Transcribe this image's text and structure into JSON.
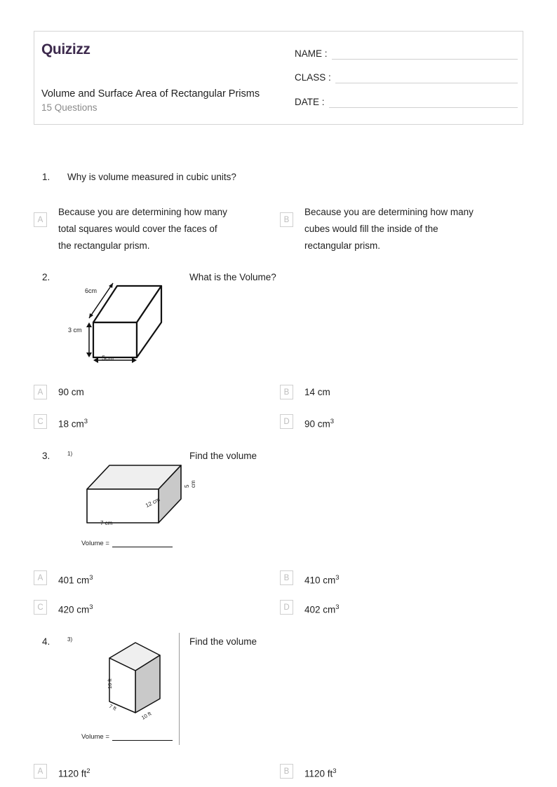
{
  "header": {
    "logo": "Quizizz",
    "title": "Volume and Surface Area of Rectangular Prisms",
    "question_count": "15 Questions",
    "fields": [
      {
        "label": "NAME :",
        "value": ""
      },
      {
        "label": "CLASS :",
        "value": ""
      },
      {
        "label": "DATE  :",
        "value": ""
      }
    ],
    "logo_color": "#3d2a4d"
  },
  "questions": [
    {
      "number": "1.",
      "prompt": "Why is volume measured in cubic units?",
      "options": [
        {
          "letter": "A",
          "line1": "Because you are determining how many",
          "line2": "total squares would cover the faces of",
          "line3": "the rectangular prism."
        },
        {
          "letter": "B",
          "line1": "Because you are determining how many",
          "line2": "cubes would fill the inside of the",
          "line3": "rectangular prism."
        }
      ]
    },
    {
      "number": "2.",
      "prompt": "What is the Volume?",
      "figure": {
        "type": "rectangular-prism-outline",
        "labels": {
          "depth": "6cm",
          "height": "3 cm",
          "width": "5cm"
        }
      },
      "options": [
        {
          "letter": "A",
          "text": "90 cm",
          "exp": ""
        },
        {
          "letter": "B",
          "text": "14 cm",
          "exp": ""
        },
        {
          "letter": "C",
          "text": "18 cm",
          "exp": "3"
        },
        {
          "letter": "D",
          "text": "90 cm",
          "exp": "3"
        }
      ]
    },
    {
      "number": "3.",
      "prompt": "Find the volume",
      "figure": {
        "type": "rectangular-prism-shaded",
        "tag": "1)",
        "labels": {
          "width": "7 cm",
          "depth": "12 cm",
          "height": "5 cm"
        },
        "volume_prompt": "Volume ="
      },
      "options": [
        {
          "letter": "A",
          "text": "401 cm",
          "exp": "3"
        },
        {
          "letter": "B",
          "text": "410 cm",
          "exp": "3"
        },
        {
          "letter": "C",
          "text": "420 cm",
          "exp": "3"
        },
        {
          "letter": "D",
          "text": "402 cm",
          "exp": "3"
        }
      ]
    },
    {
      "number": "4.",
      "prompt": "Find the volume",
      "figure": {
        "type": "rectangular-prism-tall-shaded",
        "tag": "3)",
        "labels": {
          "height": "16 ft",
          "width": "7 ft",
          "depth": "10 ft"
        },
        "volume_prompt": "Volume ="
      },
      "options": [
        {
          "letter": "A",
          "text": "1120 ft",
          "exp": "2"
        },
        {
          "letter": "B",
          "text": "1120 ft",
          "exp": "3"
        }
      ]
    }
  ]
}
